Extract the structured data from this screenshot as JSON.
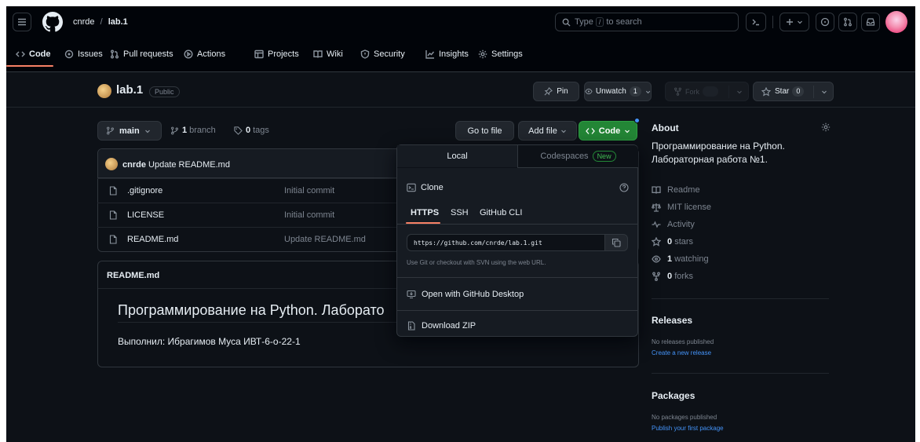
{
  "header": {
    "owner": "cnrde",
    "separator": "/",
    "repo": "lab.1",
    "search_placeholder_pre": "Type",
    "search_key": "/",
    "search_placeholder_post": "to search"
  },
  "tabs": [
    {
      "label": "Code",
      "icon": "code-icon",
      "selected": true
    },
    {
      "label": "Issues",
      "icon": "issue-icon"
    },
    {
      "label": "Pull requests",
      "icon": "pull-request-icon"
    },
    {
      "label": "Actions",
      "icon": "play-icon"
    },
    {
      "label": "Projects",
      "icon": "table-icon"
    },
    {
      "label": "Wiki",
      "icon": "book-icon"
    },
    {
      "label": "Security",
      "icon": "shield-icon"
    },
    {
      "label": "Insights",
      "icon": "graph-icon"
    },
    {
      "label": "Settings",
      "icon": "gear-icon"
    }
  ],
  "repo": {
    "name": "lab.1",
    "visibility": "Public",
    "pin_label": "Pin",
    "unwatch_label": "Unwatch",
    "watch_count": "1",
    "fork_label": "Fork",
    "star_label": "Star",
    "star_count": "0"
  },
  "toolbar": {
    "branch": "main",
    "branch_count": "1",
    "branch_label": "branch",
    "tag_count": "0",
    "tag_label": "tags",
    "go_to_file": "Go to file",
    "add_file": "Add file",
    "code": "Code"
  },
  "commit": {
    "author": "cnrde",
    "message": "Update README.md"
  },
  "files": [
    {
      "name": ".gitignore",
      "commit": "Initial commit"
    },
    {
      "name": "LICENSE",
      "commit": "Initial commit"
    },
    {
      "name": "README.md",
      "commit": "Update README.md"
    }
  ],
  "readme": {
    "file_label": "README.md",
    "heading": "Программирование на Python. Лаборато",
    "text": "Выполнил: Ибрагимов Муса ИВТ-6-о-22-1"
  },
  "clone_menu": {
    "tab_local": "Local",
    "tab_codespaces": "Codespaces",
    "new_badge": "New",
    "clone_title": "Clone",
    "proto_https": "HTTPS",
    "proto_ssh": "SSH",
    "proto_cli": "GitHub CLI",
    "url": "https://github.com/cnrde/lab.1.git",
    "hint": "Use Git or checkout with SVN using the web URL.",
    "open_desktop": "Open with GitHub Desktop",
    "download_zip": "Download ZIP"
  },
  "about": {
    "title": "About",
    "description": "Программирование на Python. Лабораторная работа №1.",
    "readme": "Readme",
    "license": "MIT license",
    "activity": "Activity",
    "stars_count": "0",
    "stars_label": "stars",
    "watching_count": "1",
    "watching_label": "watching",
    "forks_count": "0",
    "forks_label": "forks"
  },
  "releases": {
    "title": "Releases",
    "none": "No releases published",
    "create": "Create a new release"
  },
  "packages": {
    "title": "Packages",
    "none": "No packages published",
    "publish": "Publish your first package"
  },
  "colors": {
    "bg": "#0d1117",
    "header_bg": "#010409",
    "green": "#238636",
    "link": "#4493f8",
    "accent": "#f78166"
  }
}
